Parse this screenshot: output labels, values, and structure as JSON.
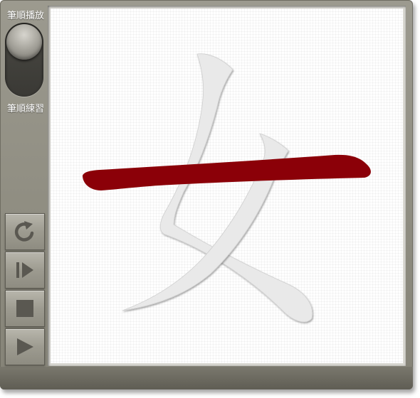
{
  "toggle": {
    "top_label": "筆順播放",
    "bottom_label": "筆順練習",
    "selected": "筆順播放"
  },
  "controls": [
    {
      "name": "replay-button",
      "icon": "refresh-icon"
    },
    {
      "name": "step-forward-button",
      "icon": "step-forward-icon"
    },
    {
      "name": "stop-button",
      "icon": "stop-icon"
    },
    {
      "name": "play-button",
      "icon": "play-icon"
    }
  ],
  "character": {
    "glyph": "女",
    "stroke_count": 3,
    "current_stroke": 3
  },
  "colors": {
    "frame": "#918f84",
    "active_stroke": "#8b0008",
    "ghost_stroke": "#e9e9e9",
    "icon": "#5a5851"
  }
}
